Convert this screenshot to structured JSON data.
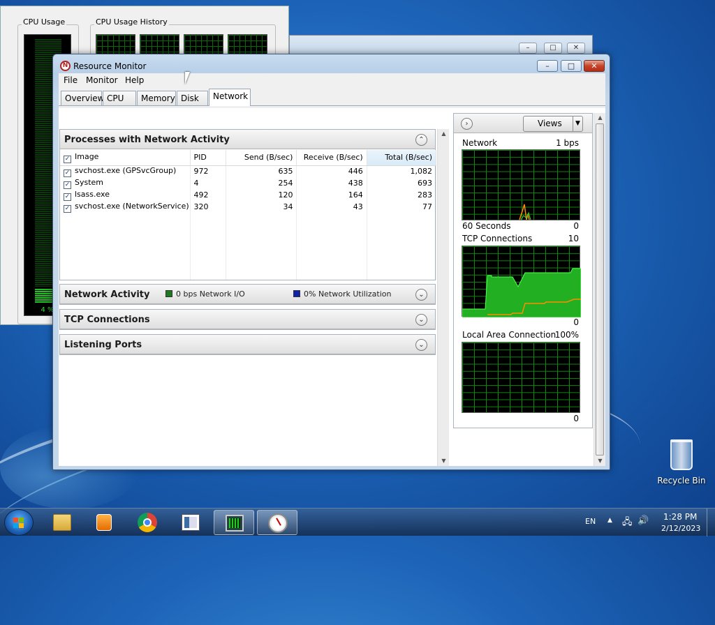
{
  "task_manager": {
    "cpu_usage_label": "CPU Usage",
    "cpu_history_label": "CPU Usage History",
    "cpu_percent": "4 %"
  },
  "window": {
    "title": "Resource Monitor",
    "minimize": "–",
    "maximize": "□",
    "close": "✕"
  },
  "menu": [
    "File",
    "Monitor",
    "Help"
  ],
  "tabs": [
    "Overview",
    "CPU",
    "Memory",
    "Disk",
    "Network"
  ],
  "active_tab": "Network",
  "processes": {
    "title": "Processes with Network Activity",
    "columns": [
      "Image",
      "PID",
      "Send (B/sec)",
      "Receive (B/sec)",
      "Total (B/sec)"
    ],
    "rows": [
      {
        "image": "svchost.exe (GPSvcGroup)",
        "pid": "972",
        "send": "635",
        "receive": "446",
        "total": "1,082"
      },
      {
        "image": "System",
        "pid": "4",
        "send": "254",
        "receive": "438",
        "total": "693"
      },
      {
        "image": "lsass.exe",
        "pid": "492",
        "send": "120",
        "receive": "164",
        "total": "283"
      },
      {
        "image": "svchost.exe (NetworkService)",
        "pid": "320",
        "send": "34",
        "receive": "43",
        "total": "77"
      }
    ]
  },
  "network_activity": {
    "title": "Network Activity",
    "io_legend": "0 bps Network I/O",
    "util_legend": "0% Network Utilization",
    "io_color": "#1f7a1f",
    "util_color": "#1020b0"
  },
  "tcp_connections": {
    "title": "TCP Connections"
  },
  "listening_ports": {
    "title": "Listening Ports"
  },
  "right_pane": {
    "views_label": "Views",
    "graphs": [
      {
        "title": "Network",
        "max": "1 bps",
        "left_footer": "60 Seconds",
        "min": "0"
      },
      {
        "title": "TCP Connections",
        "max": "10",
        "left_footer": "",
        "min": "0"
      },
      {
        "title": "Local Area Connection",
        "max": "100%",
        "left_footer": "",
        "min": "0"
      }
    ]
  },
  "taskbar": {
    "lang": "EN",
    "time": "1:28 PM",
    "date": "2/12/2023"
  },
  "desktop": {
    "recycle_bin": "Recycle Bin"
  }
}
